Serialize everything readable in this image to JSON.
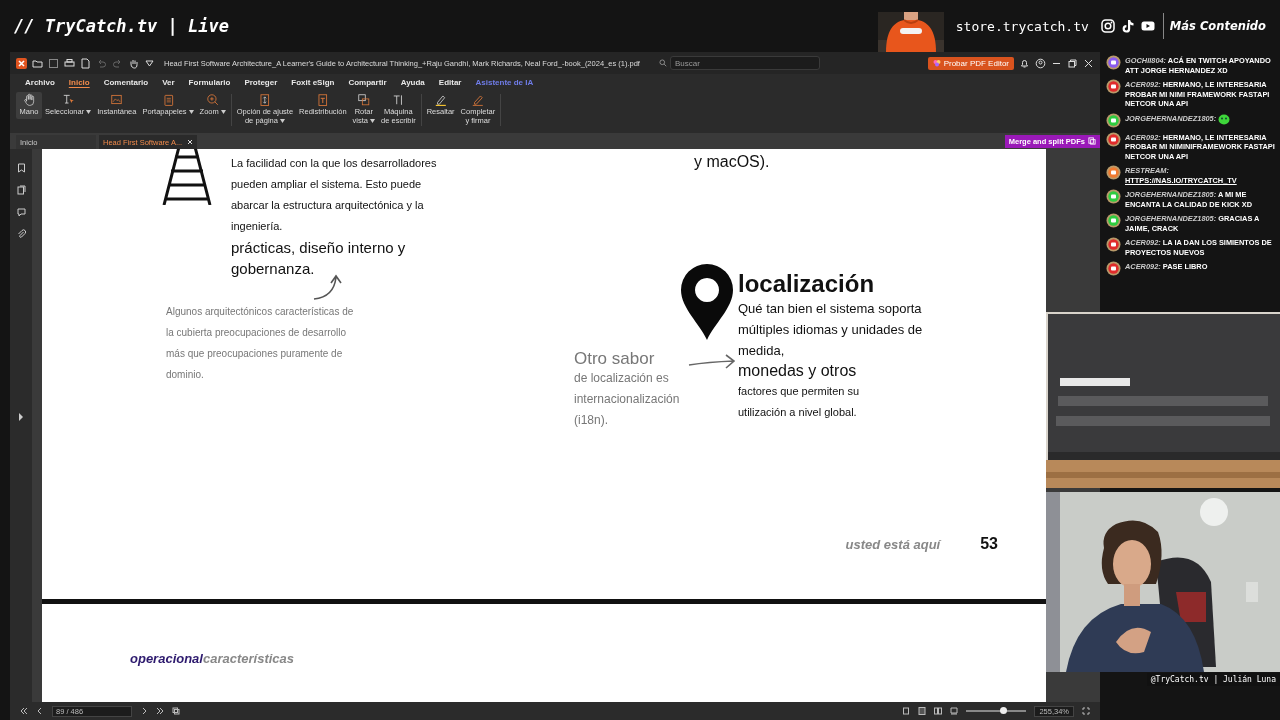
{
  "stream_header": {
    "title": "// TryCatch.tv | Live",
    "store": "store.trycatch.tv",
    "more": "Más Contenido"
  },
  "window": {
    "title": "Head First Software Architecture_A Learner's Guide to Architectural Thinking_+Raju Gandhi, Mark Richards, Neal Ford_-book_(2024_es (1).pdf",
    "search": {
      "placeholder": "Buscar"
    },
    "promo": "Probar PDF Editor"
  },
  "menu": [
    {
      "label": "Archivo",
      "selected": false,
      "kind": "plain"
    },
    {
      "label": "Inicio",
      "selected": true,
      "kind": "plain"
    },
    {
      "label": "Comentario",
      "selected": false,
      "kind": "plain"
    },
    {
      "label": "Ver",
      "selected": false,
      "kind": "plain"
    },
    {
      "label": "Formulario",
      "selected": false,
      "kind": "plain"
    },
    {
      "label": "Proteger",
      "selected": false,
      "kind": "plain"
    },
    {
      "label": "Foxit eSign",
      "selected": false,
      "kind": "plain"
    },
    {
      "label": "Compartir",
      "selected": false,
      "kind": "plain"
    },
    {
      "label": "Ayuda",
      "selected": false,
      "kind": "plain"
    },
    {
      "label": "Editar",
      "selected": false,
      "kind": "plain"
    },
    {
      "label": "Asistente de IA",
      "selected": false,
      "kind": "ai"
    }
  ],
  "ribbon": [
    {
      "lines": [
        "Mano"
      ],
      "selected": true,
      "dropdown": false
    },
    {
      "lines": [
        "Seleccionar"
      ],
      "selected": false,
      "dropdown": true
    },
    {
      "lines": [
        "Instantánea"
      ],
      "selected": false,
      "dropdown": false
    },
    {
      "lines": [
        "Portapapeles"
      ],
      "selected": false,
      "dropdown": true
    },
    {
      "lines": [
        "Zoom"
      ],
      "selected": false,
      "dropdown": true
    },
    {
      "lines": [
        "Opción de ajuste",
        "de página"
      ],
      "selected": false,
      "dropdown": true
    },
    {
      "lines": [
        "Redistribución"
      ],
      "selected": false,
      "dropdown": false
    },
    {
      "lines": [
        "Rotar",
        "vista"
      ],
      "selected": false,
      "dropdown": true
    },
    {
      "lines": [
        "Máquina",
        "de escribir"
      ],
      "selected": false,
      "dropdown": false
    },
    {
      "lines": [
        "Resaltar"
      ],
      "selected": false,
      "dropdown": false
    },
    {
      "lines": [
        "Completar",
        "y firmar"
      ],
      "selected": false,
      "dropdown": false
    }
  ],
  "doc_tabs": [
    {
      "label": "Inicio",
      "selected": false,
      "closable": false
    },
    {
      "label": "Head First Software A...",
      "selected": true,
      "closable": true
    }
  ],
  "merge_badge": "Merge and split PDFs",
  "page": {
    "scalability_text": "La facilidad con la que los desarrolladores pueden ampliar el sistema. Esto puede abarcar la estructura arquitectónica y la ingeniería.",
    "scalability_more": "prácticas, diseño interno y gobernanza.",
    "note": "Algunos arquitectónicos características de la cubierta preocupaciones de desarrollo más que preocupaciones puramente de dominio.",
    "macos": "y macOS).",
    "heading": "localización",
    "description": "Qué tan bien el sistema soporta múltiples idiomas y unidades de medida,",
    "description_big": "monedas y otros",
    "description_small": "factores que permiten su utilización a nivel global.",
    "aside_title": "Otro sabor",
    "aside_text": "de localización es internacionalización (i18n).",
    "footer_text": "usted está aquí",
    "page_number": "53"
  },
  "next_page": {
    "heading": "**operacional**características"
  },
  "status_bar": {
    "page_field": "89 / 486",
    "zoom": "255,34%",
    "zoom_slider": {
      "level": 0.62
    }
  },
  "chat": [
    {
      "color": "#8a5cf0",
      "kind": "text",
      "user": "GOCHII804:",
      "message": "ACÁ EN TWITCH APOYANDO ATT JORGE HERNANDEZ XD"
    },
    {
      "color": "#e02b2b",
      "kind": "text",
      "user": "ACER092:",
      "message": "HERMANO, LE INTERESARIA PROBAR MI NIMI FRAMEWORK FASTAPI NETCOR UNA API"
    },
    {
      "color": "#2ecc40",
      "kind": "emote",
      "user": "JORGEHERNANDEZ1805:"
    },
    {
      "color": "#e02b2b",
      "kind": "text",
      "user": "ACER092:",
      "message": "HERMANO, LE INTERESARIA PROBAR MI NIMINIFRAMEWORK FASTAPI NETCOR UNA API"
    },
    {
      "color": "#f07a30",
      "kind": "link",
      "user": "RESTREAM:",
      "message": "HTTPS://NAS.IO/TRYCATCH_TV"
    },
    {
      "color": "#2ecc40",
      "kind": "text",
      "user": "JORGEHERNANDEZ1805:",
      "message": "A MI ME ENCANTA LA CALIDAD DE KICK XD"
    },
    {
      "color": "#2ecc40",
      "kind": "text",
      "user": "JORGEHERNANDEZ1805:",
      "message": "GRACIAS A JAIME, CRACK"
    },
    {
      "color": "#e02b2b",
      "kind": "text",
      "user": "ACER092:",
      "message": "LA IA DAN LOS SIMIENTOS DE PROYECTOS NUEVOS"
    },
    {
      "color": "#e02b2b",
      "kind": "text",
      "user": "ACER092:",
      "message": "PASE LIBRO"
    }
  ],
  "camera_caption": "@TryCatch.tv | Julián Luna"
}
